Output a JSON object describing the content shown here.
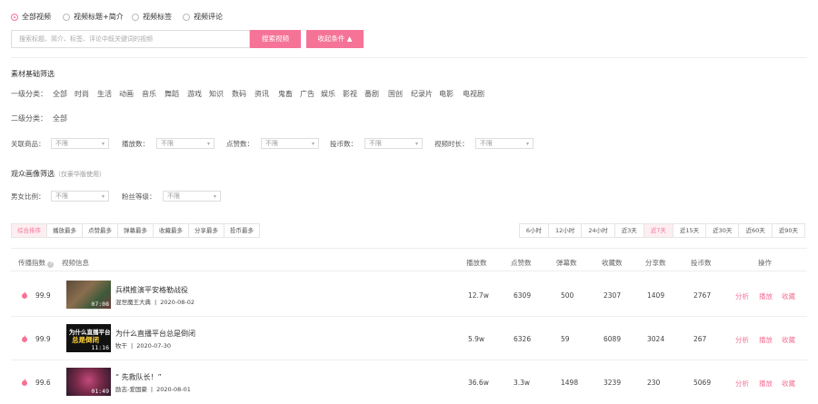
{
  "search_modes": [
    "全部视频",
    "视频标题+简介",
    "视频标签",
    "视频评论"
  ],
  "search": {
    "placeholder": "搜索标题、简介、标签、评论中既关键词的视频",
    "button": "搜索视频",
    "toggle": "收起条件 ▲"
  },
  "basic_filter": {
    "title": "素材基础筛选",
    "primary_label": "一级分类：",
    "primary": [
      "全部",
      "时尚",
      "生活",
      "动画",
      "音乐",
      "舞蹈",
      "游戏",
      "知识",
      "数码",
      "资讯",
      "鬼畜",
      "广告",
      "娱乐",
      "影视",
      "番剧",
      "国创",
      "纪录片",
      "电影",
      "电视剧"
    ],
    "secondary_label": "二级分类：",
    "secondary": [
      "全部"
    ],
    "dropdowns": [
      {
        "label": "关联商品：",
        "value": "不限"
      },
      {
        "label": "播放数：",
        "value": "不限"
      },
      {
        "label": "点赞数：",
        "value": "不限"
      },
      {
        "label": "投币数：",
        "value": "不限"
      },
      {
        "label": "视频时长：",
        "value": "不限"
      }
    ]
  },
  "audience_filter": {
    "title": "观众画像筛选",
    "note": "（仅豪华版使用）",
    "dropdowns": [
      {
        "label": "男女比例：",
        "value": "不限"
      },
      {
        "label": "粉丝等级：",
        "value": "不限"
      }
    ]
  },
  "sort_tabs": [
    "综合排序",
    "播放最多",
    "点赞最多",
    "弹幕最多",
    "收藏最多",
    "分享最多",
    "投币最多"
  ],
  "time_tabs": [
    "6小时",
    "12小时",
    "24小时",
    "近3天",
    "近7天",
    "近15天",
    "近30天",
    "近60天",
    "近90天"
  ],
  "table": {
    "headers": [
      "传播指数",
      "视频信息",
      "播放数",
      "点赞数",
      "弹幕数",
      "收藏数",
      "分享数",
      "投币数",
      "操作"
    ],
    "actions": [
      "分析",
      "播放",
      "收藏"
    ],
    "rows": [
      {
        "index": "99.9",
        "title": "兵棋推演平安格勒战役",
        "author": "混世魔王大典",
        "date": "2020-08-02",
        "duration": "07:08",
        "plays": "12.7w",
        "likes": "6309",
        "danmaku": "500",
        "favs": "2307",
        "shares": "1409",
        "coins": "2767"
      },
      {
        "index": "99.9",
        "title": "为什么直播平台总是倒闭",
        "author": "牧干",
        "date": "2020-07-30",
        "duration": "11:16",
        "plays": "5.9w",
        "likes": "6326",
        "danmaku": "59",
        "favs": "6089",
        "shares": "3024",
        "coins": "267",
        "thumb_text": [
          "为什么直播平台",
          "总是倒闭"
        ]
      },
      {
        "index": "99.6",
        "title": "“ 先救队长！”",
        "author": "励志-爱国豪",
        "date": "2020-08-01",
        "duration": "01:49",
        "plays": "36.6w",
        "likes": "3.3w",
        "danmaku": "1498",
        "favs": "3239",
        "shares": "230",
        "coins": "5069"
      }
    ]
  },
  "colors": {
    "accent": "#f57396"
  }
}
